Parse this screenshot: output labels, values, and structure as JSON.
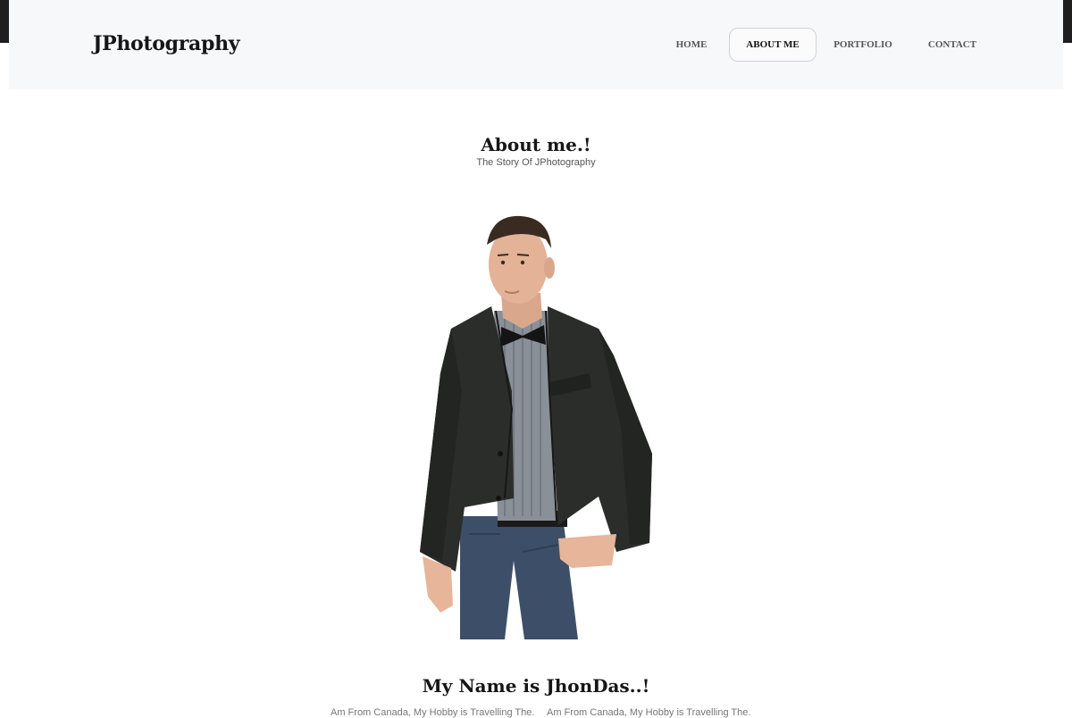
{
  "brand": {
    "logo": "JPhotography"
  },
  "nav": {
    "items": [
      {
        "label": "HOME"
      },
      {
        "label": "ABOUT ME",
        "active": true
      },
      {
        "label": "PORTFOLIO"
      },
      {
        "label": "CONTACT"
      }
    ]
  },
  "about": {
    "title": "About me.!",
    "subtitle": "The Story Of JPhotography"
  },
  "profile": {
    "name_heading": "My Name is JhonDas..!",
    "bio_left": "Am From Canada, My Hobby is Travelling The...",
    "bio_right": "Am From Canada, My Hobby is Travelling The..."
  },
  "colors": {
    "header_bg": "#f7f8fa",
    "text_dark": "#161616",
    "nav_text": "#555555"
  }
}
